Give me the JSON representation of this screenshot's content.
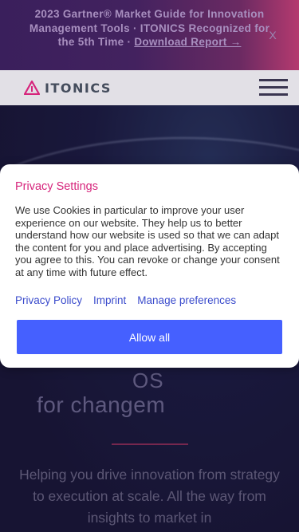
{
  "banner": {
    "text": "2023 Gartner® Market Guide for Innovation Management Tools · ITONICS Recognized for the 5th Time · ",
    "link_label": "Download Report →",
    "close_label": "X"
  },
  "header": {
    "logo_text": "ITONICS",
    "logo_icon": "itonics-triangle-logo",
    "menu_icon": "hamburger-menu-icon"
  },
  "hero": {
    "title_line1": "OS",
    "title_line2": "for changem",
    "subtitle": "Helping you drive innovation from strategy to execution at scale. All the way from insights to market in"
  },
  "cookie_modal": {
    "title": "Privacy Settings",
    "body": "We use Cookies in particular to improve your user experience on our website. They help us to better understand how our website is used so that we can adapt the content for you and place advertising. By accepting you agree to this. You can revoke or change your consent at any time with future effect.",
    "links": [
      "Privacy Policy",
      "Imprint",
      "Manage preferences"
    ],
    "allow_all_label": "Allow all"
  },
  "colors": {
    "accent_pink": "#d6257c",
    "button_blue": "#4560ff",
    "link_blue": "#3a4bcc"
  }
}
